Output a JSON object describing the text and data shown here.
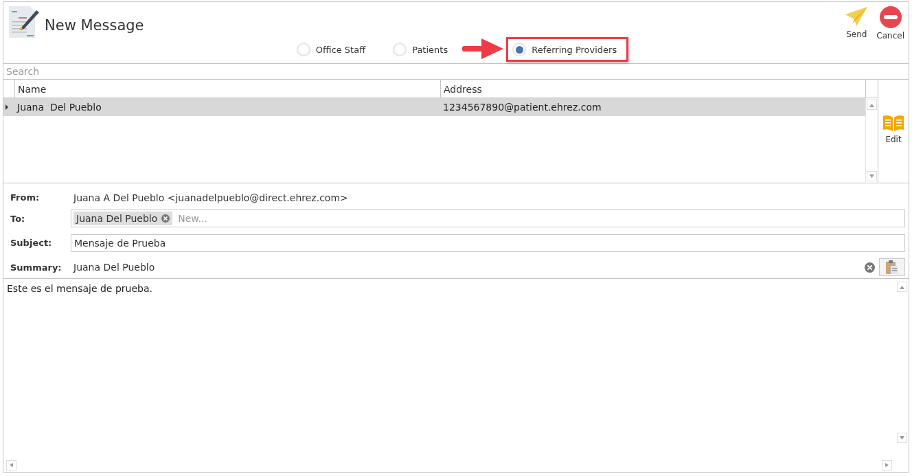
{
  "window": {
    "title": "New Message"
  },
  "toolbar": [
    {
      "kind": "send",
      "label": "Send"
    },
    {
      "kind": "cancel",
      "label": "Cancel"
    }
  ],
  "recipient_types": [
    {
      "label": "Office Staff",
      "selected": false,
      "highlighted": false
    },
    {
      "label": "Patients",
      "selected": false,
      "highlighted": false
    },
    {
      "label": "Referring Providers",
      "selected": true,
      "highlighted": true
    }
  ],
  "search": {
    "placeholder": "Search"
  },
  "table": {
    "columns": [
      "Name",
      "Address"
    ],
    "rows": [
      {
        "cells": [
          "Juana  Del Pueblo",
          "1234567890@patient.ehrez.com"
        ],
        "selected": true
      }
    ]
  },
  "side_actions": [
    {
      "label": "Edit"
    }
  ],
  "form": {
    "from_label": "From:",
    "from": "Juana A Del Pueblo <juanadelpueblo@direct.ehrez.com>",
    "to_label": "To:",
    "to_chips": [
      "Juana Del Pueblo"
    ],
    "to_placeholder": "New...",
    "subject_label": "Subject:",
    "subject": "Mensaje de Prueba",
    "summary_label": "Summary:",
    "summary": "Juana Del Pueblo"
  },
  "body": "Este es el mensaje de prueba."
}
